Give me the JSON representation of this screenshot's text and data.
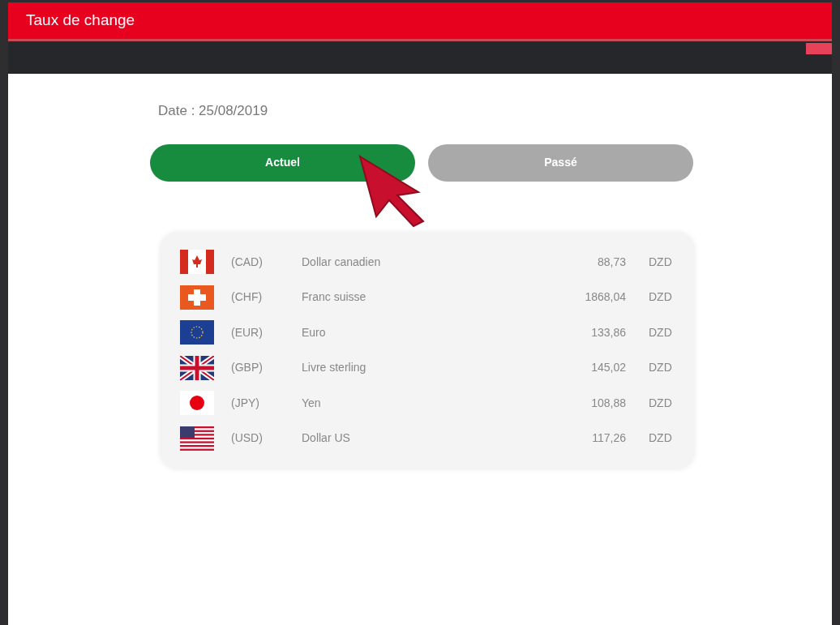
{
  "header": {
    "title": "Taux de change"
  },
  "date": "Date : 25/08/2019",
  "tabs": [
    {
      "label": "Actuel",
      "selected": true
    },
    {
      "label": "Passé",
      "selected": false
    }
  ],
  "rates": [
    {
      "kind": "ca",
      "code": "(CAD)",
      "name": "Dollar canadien",
      "value": "88,73",
      "unit": "DZD"
    },
    {
      "kind": "ch",
      "code": "(CHF)",
      "name": "Franc suisse",
      "value": "1868,04",
      "unit": "DZD"
    },
    {
      "kind": "eu",
      "code": "(EUR)",
      "name": "Euro",
      "value": "133,86",
      "unit": "DZD"
    },
    {
      "kind": "gb",
      "code": "(GBP)",
      "name": "Livre sterling",
      "value": "145,02",
      "unit": "DZD"
    },
    {
      "kind": "jp",
      "code": "(JPY)",
      "name": "Yen",
      "value": "108,88",
      "unit": "DZD"
    },
    {
      "kind": "us",
      "code": "(USD)",
      "name": "Dollar US",
      "value": "117,26",
      "unit": "DZD"
    }
  ]
}
